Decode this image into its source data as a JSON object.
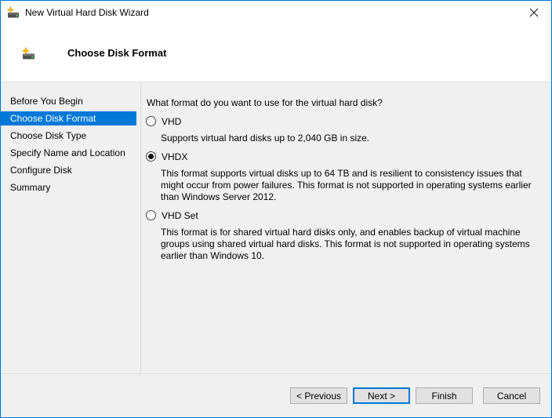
{
  "window": {
    "title": "New Virtual Hard Disk Wizard"
  },
  "header": {
    "title": "Choose Disk Format"
  },
  "sidebar": {
    "items": [
      {
        "label": "Before You Begin",
        "active": false
      },
      {
        "label": "Choose Disk Format",
        "active": true
      },
      {
        "label": "Choose Disk Type",
        "active": false
      },
      {
        "label": "Specify Name and Location",
        "active": false
      },
      {
        "label": "Configure Disk",
        "active": false
      },
      {
        "label": "Summary",
        "active": false
      }
    ]
  },
  "content": {
    "question": "What format do you want to use for the virtual hard disk?",
    "options": [
      {
        "label": "VHD",
        "selected": false,
        "description": "Supports virtual hard disks up to 2,040 GB in size."
      },
      {
        "label": "VHDX",
        "selected": true,
        "description": "This format supports virtual disks up to 64 TB and is resilient to consistency issues that might occur from power failures. This format is not supported in operating systems earlier than Windows Server 2012."
      },
      {
        "label": "VHD Set",
        "selected": false,
        "description": "This format is for shared virtual hard disks only, and enables backup of virtual machine groups using shared virtual hard disks. This format is not supported in operating systems earlier than Windows 10."
      }
    ]
  },
  "footer": {
    "buttons": [
      {
        "label": "< Previous",
        "focused": false
      },
      {
        "label": "Next >",
        "focused": true
      },
      {
        "label": "Finish",
        "focused": false
      },
      {
        "label": "Cancel",
        "focused": false
      }
    ]
  },
  "icons": {
    "app_icon": "new-virtual-hard-disk-icon",
    "close": "close-icon"
  },
  "colors": {
    "accent": "#0078d7",
    "body_bg": "#f0f0f0",
    "titlebar_bg": "#ffffff",
    "button_face": "#e1e1e1",
    "button_border": "#adadad",
    "sidebar_highlight": "#0078d7",
    "separator": "#dfdfdf"
  }
}
